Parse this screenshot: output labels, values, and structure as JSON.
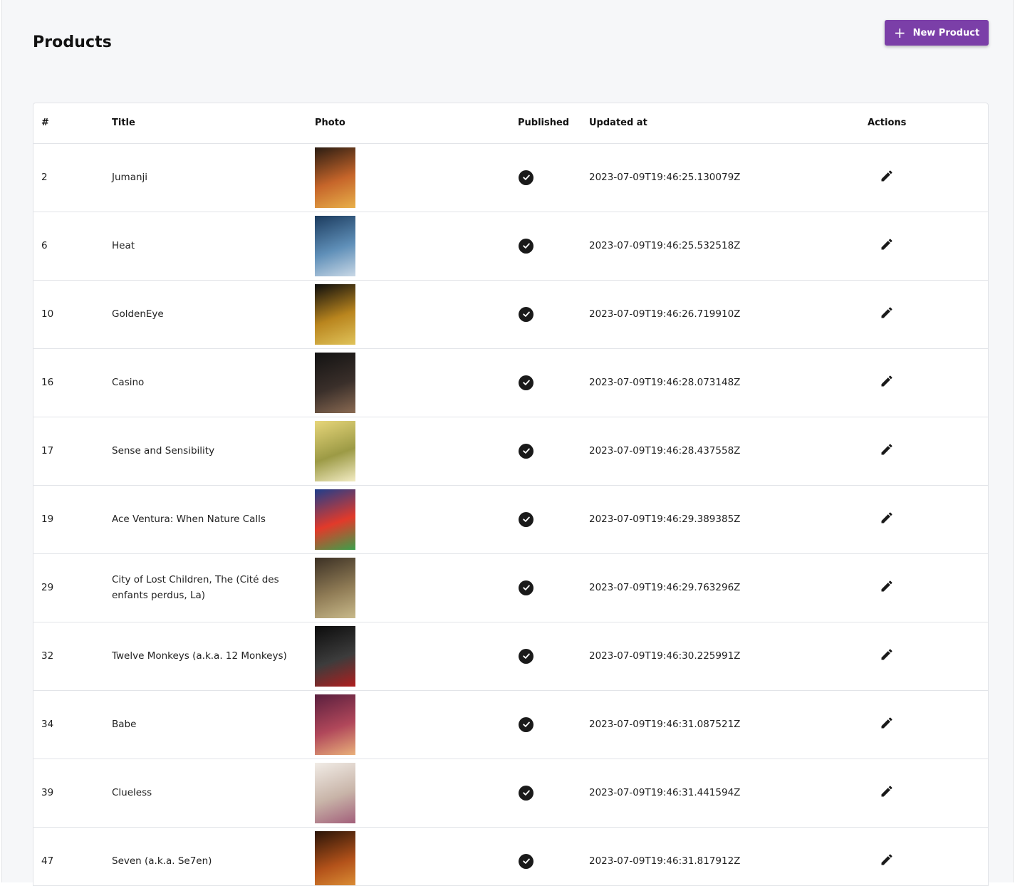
{
  "header": {
    "title": "Products",
    "new_button": "New Product"
  },
  "table": {
    "columns": [
      "#",
      "Title",
      "Photo",
      "Published",
      "Updated at",
      "Actions"
    ],
    "rows": [
      {
        "id": "2",
        "title": "Jumanji",
        "updated_at": "2023-07-09T19:46:25.130079Z",
        "published": true,
        "poster_colors": [
          "#2a1c12",
          "#c6652a",
          "#e8b04a"
        ]
      },
      {
        "id": "6",
        "title": "Heat",
        "updated_at": "2023-07-09T19:46:25.532518Z",
        "published": true,
        "poster_colors": [
          "#1b3b5e",
          "#5f8fb8",
          "#c9d8e6"
        ]
      },
      {
        "id": "10",
        "title": "GoldenEye",
        "updated_at": "2023-07-09T19:46:26.719910Z",
        "published": true,
        "poster_colors": [
          "#0d0d0d",
          "#b9851e",
          "#e0c35a"
        ]
      },
      {
        "id": "16",
        "title": "Casino",
        "updated_at": "2023-07-09T19:46:28.073148Z",
        "published": true,
        "poster_colors": [
          "#121212",
          "#3a2f2a",
          "#8a6a52"
        ]
      },
      {
        "id": "17",
        "title": "Sense and Sensibility",
        "updated_at": "2023-07-09T19:46:28.437558Z",
        "published": true,
        "poster_colors": [
          "#e7d67a",
          "#9c9a45",
          "#f3ecc4"
        ]
      },
      {
        "id": "19",
        "title": "Ace Ventura: When Nature Calls",
        "updated_at": "2023-07-09T19:46:29.389385Z",
        "published": true,
        "poster_colors": [
          "#1f3e8c",
          "#e23a2a",
          "#3aa14a"
        ]
      },
      {
        "id": "29",
        "title": "City of Lost Children, The (Cité des enfants perdus, La)",
        "updated_at": "2023-07-09T19:46:29.763296Z",
        "published": true,
        "poster_colors": [
          "#3b3024",
          "#8f7b55",
          "#c8b98a"
        ]
      },
      {
        "id": "32",
        "title": "Twelve Monkeys (a.k.a. 12 Monkeys)",
        "updated_at": "2023-07-09T19:46:30.225991Z",
        "published": true,
        "poster_colors": [
          "#0c0c0c",
          "#3c3c3c",
          "#b01e1e"
        ]
      },
      {
        "id": "34",
        "title": "Babe",
        "updated_at": "2023-07-09T19:46:31.087521Z",
        "published": true,
        "poster_colors": [
          "#5a1f3e",
          "#b0475a",
          "#e9b07a"
        ]
      },
      {
        "id": "39",
        "title": "Clueless",
        "updated_at": "2023-07-09T19:46:31.441594Z",
        "published": true,
        "poster_colors": [
          "#f1ece6",
          "#c8b4a8",
          "#a25f7a"
        ]
      },
      {
        "id": "47",
        "title": "Seven (a.k.a. Se7en)",
        "updated_at": "2023-07-09T19:46:31.817912Z",
        "published": true,
        "poster_colors": [
          "#2a1408",
          "#b3521a",
          "#e39a3a"
        ]
      }
    ]
  },
  "icons": {
    "published": "check-circle-icon",
    "edit": "pencil-icon",
    "add": "plus-icon"
  },
  "colors": {
    "accent": "#7b3fa8",
    "background": "#f6f7f9"
  }
}
